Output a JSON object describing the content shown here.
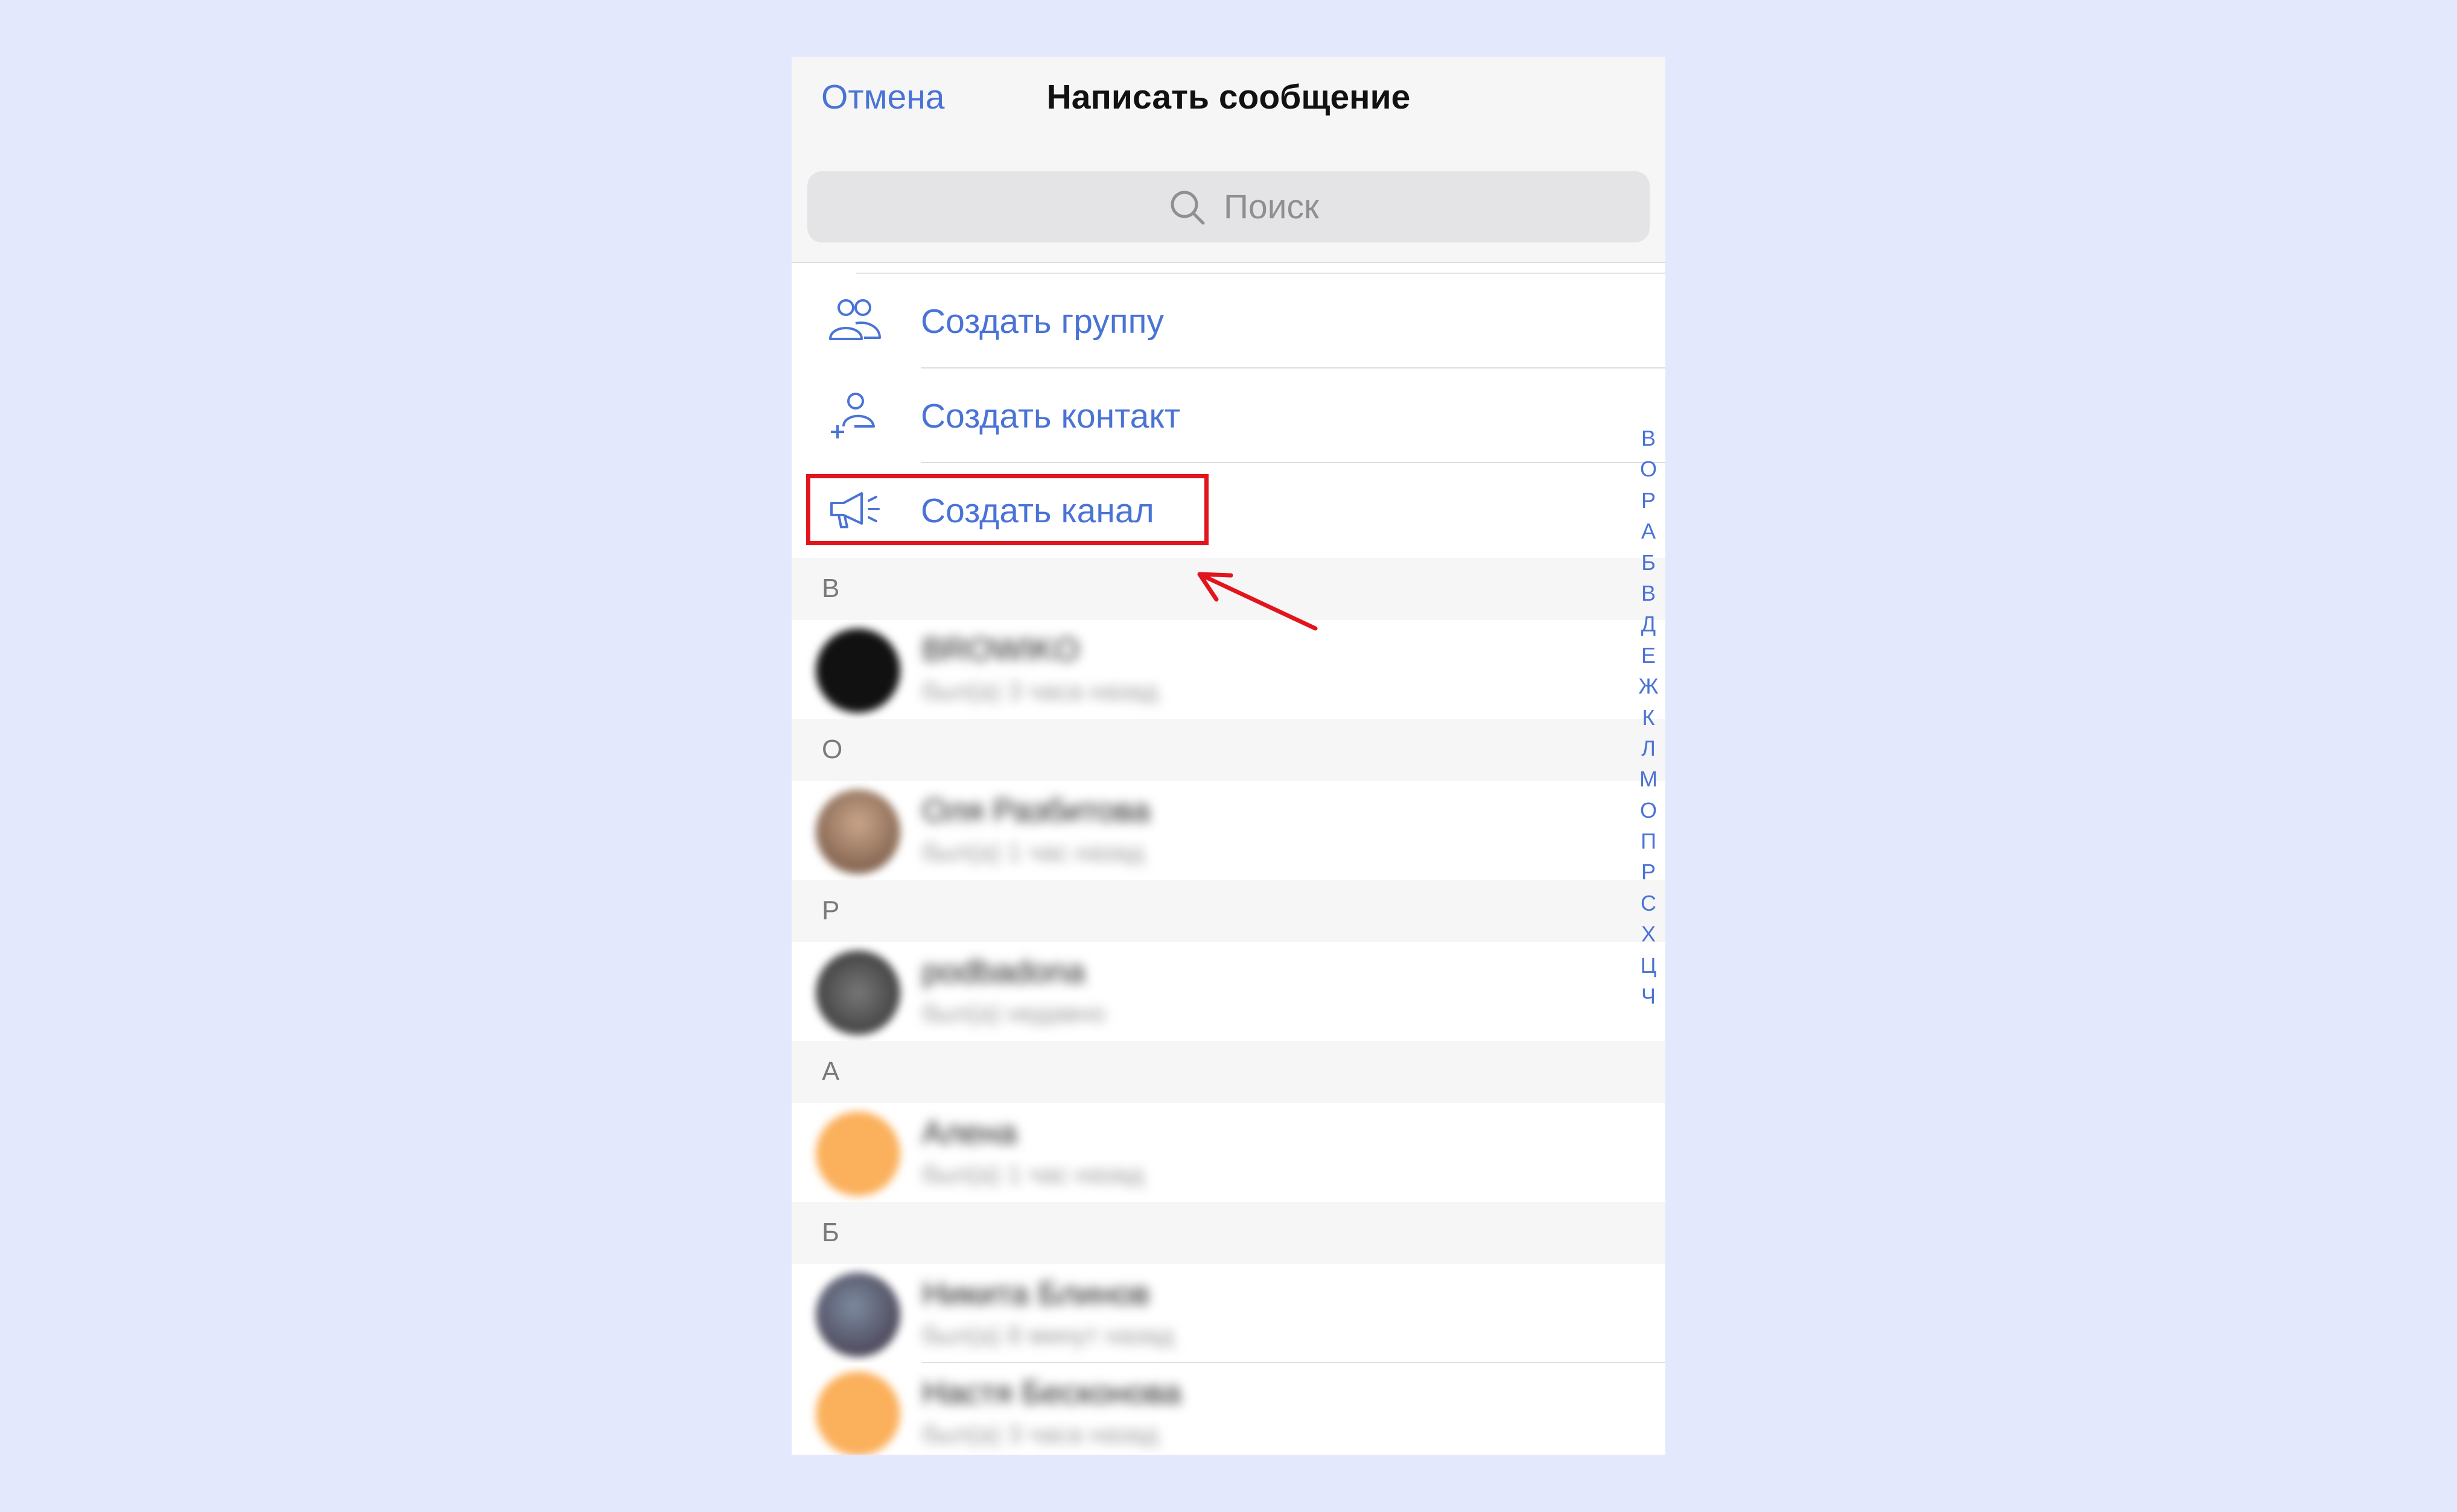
{
  "nav": {
    "cancel_label": "Отмена",
    "title": "Написать сообщение"
  },
  "search": {
    "placeholder": "Поиск",
    "icon": "search-icon"
  },
  "actions": [
    {
      "label": "Создать группу",
      "icon": "group-icon"
    },
    {
      "label": "Создать контакт",
      "icon": "add-contact-icon"
    },
    {
      "label": "Создать канал",
      "icon": "megaphone-icon"
    }
  ],
  "sections": [
    {
      "letter": "В",
      "contacts": [
        {
          "name": "BROWIKO",
          "status": "был(а) 3 часа назад",
          "avatar_color": "#111111"
        }
      ]
    },
    {
      "letter": "О",
      "contacts": [
        {
          "name": "Оля Разбитова",
          "status": "был(а) 1 час назад",
          "avatar_color": "#8a6a55"
        }
      ]
    },
    {
      "letter": "Р",
      "contacts": [
        {
          "name": "podbadona",
          "status": "был(а) недавно",
          "avatar_color": "#3a3a3a"
        }
      ]
    },
    {
      "letter": "А",
      "contacts": [
        {
          "name": "Алена",
          "status": "был(а) 1 час назад",
          "avatar_color": "#fbb05c"
        }
      ]
    },
    {
      "letter": "Б",
      "contacts": [
        {
          "name": "Никита Блинов",
          "status": "был(а) 8 минут назад",
          "avatar_color": "#4b5a72"
        },
        {
          "name": "Настя Бесконова",
          "status": "был(а) 3 часа назад",
          "avatar_color": "#fbb05c"
        }
      ]
    }
  ],
  "alphabet_index": [
    "В",
    "О",
    "Р",
    "А",
    "Б",
    "В",
    "Д",
    "Е",
    "Ж",
    "К",
    "Л",
    "М",
    "О",
    "П",
    "Р",
    "С",
    "Х",
    "Ц",
    "Ч"
  ],
  "colors": {
    "accent": "#4a73d6",
    "highlight": "#e2141c",
    "background": "#e4e8fd"
  }
}
